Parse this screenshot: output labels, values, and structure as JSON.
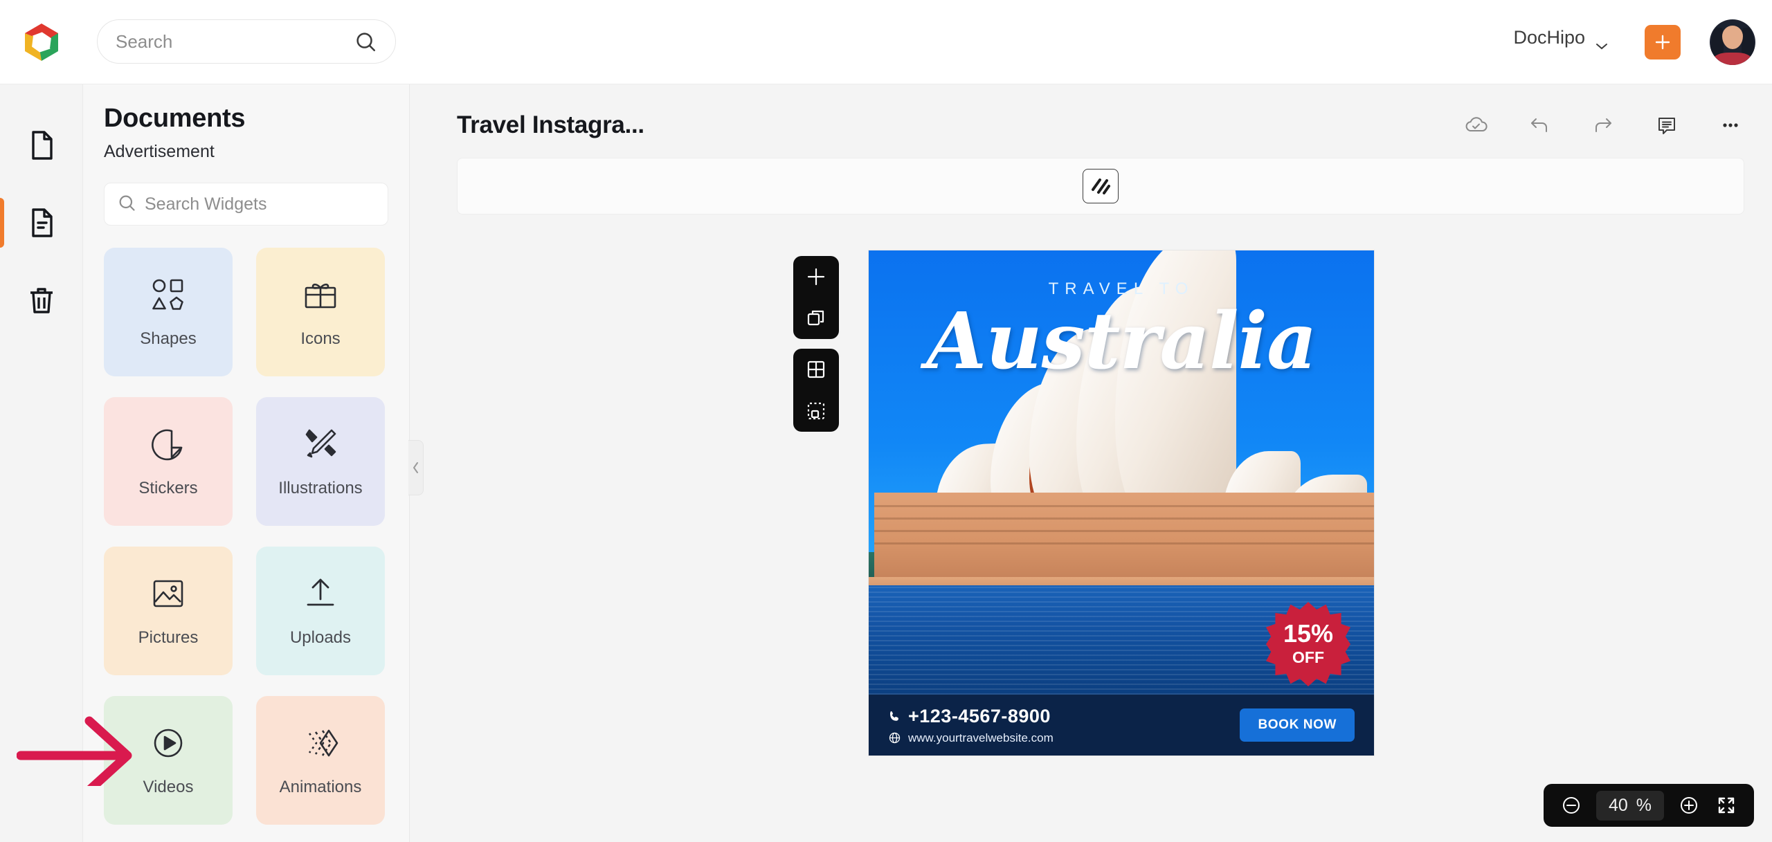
{
  "app": {
    "brand": "DocHipo"
  },
  "topbar": {
    "search_placeholder": "Search",
    "workspace_label": "DocHipo",
    "create_label": "+",
    "icons": {
      "search": "search-icon",
      "chevron": "chevron-down-icon",
      "plus": "plus-icon",
      "avatar": "user-avatar"
    }
  },
  "rail": {
    "items": [
      {
        "name": "templates",
        "icon": "blank-page-icon"
      },
      {
        "name": "documents",
        "icon": "document-lines-icon",
        "active": true
      },
      {
        "name": "trash",
        "icon": "trash-icon"
      }
    ]
  },
  "panel": {
    "title": "Documents",
    "subtitle": "Advertisement",
    "search_placeholder": "Search Widgets",
    "widgets": [
      {
        "label": "Shapes",
        "icon": "shapes-icon",
        "bg": "#dfe9f7"
      },
      {
        "label": "Icons",
        "icon": "gift-icon",
        "bg": "#fbeed0"
      },
      {
        "label": "Stickers",
        "icon": "sticker-icon",
        "bg": "#fbe3e0"
      },
      {
        "label": "Illustrations",
        "icon": "pencil-ruler-icon",
        "bg": "#e4e6f5"
      },
      {
        "label": "Pictures",
        "icon": "image-icon",
        "bg": "#fbe9d2"
      },
      {
        "label": "Uploads",
        "icon": "upload-icon",
        "bg": "#dff2f2"
      },
      {
        "label": "Videos",
        "icon": "play-circle-icon",
        "bg": "#e2f0e0"
      },
      {
        "label": "Animations",
        "icon": "animation-icon",
        "bg": "#fbe2d4"
      }
    ],
    "collapse_icon": "chevron-left-icon"
  },
  "canvas": {
    "document_title": "Travel Instagra...",
    "tools": [
      {
        "name": "cloud-saved-icon",
        "label": "Saved"
      },
      {
        "name": "undo-icon",
        "label": "Undo"
      },
      {
        "name": "redo-icon",
        "label": "Redo"
      },
      {
        "name": "comment-icon",
        "label": "Comments"
      },
      {
        "name": "more-options-icon",
        "label": "More"
      }
    ],
    "page_background_icon": "background-pattern-icon",
    "float_tools": [
      {
        "name": "add-page-icon"
      },
      {
        "name": "duplicate-page-icon"
      },
      {
        "name": "grid-view-icon"
      },
      {
        "name": "select-area-icon"
      }
    ]
  },
  "poster": {
    "kicker": "TRAVEL TO",
    "title": "Australia",
    "badge_percent": "15%",
    "badge_off": "OFF",
    "phone": "+123-4567-8900",
    "website": "www.yourtravelwebsite.com",
    "cta": "BOOK NOW",
    "icons": {
      "phone": "phone-icon",
      "globe": "globe-icon"
    }
  },
  "zoom_control": {
    "zoom_out_icon": "zoom-out-icon",
    "value": "40",
    "unit": "%",
    "zoom_in_icon": "zoom-in-icon",
    "fit_icon": "fit-screen-icon"
  },
  "annotation": {
    "arrow_color": "#d91a4e",
    "points_to": "Videos"
  }
}
